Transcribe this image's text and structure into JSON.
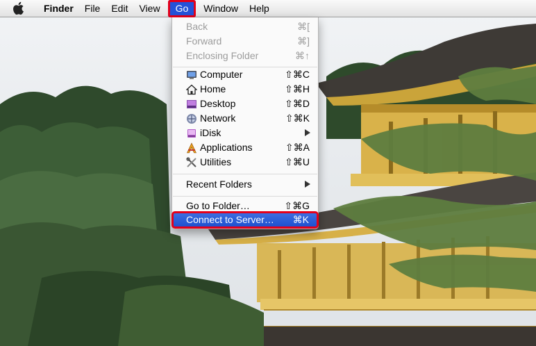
{
  "menubar": {
    "items": [
      "Finder",
      "File",
      "Edit",
      "View",
      "Go",
      "Window",
      "Help"
    ],
    "active": "Go"
  },
  "go_menu": {
    "history": [
      {
        "label": "Back",
        "shortcut": "⌘[",
        "enabled": false
      },
      {
        "label": "Forward",
        "shortcut": "⌘]",
        "enabled": false
      },
      {
        "label": "Enclosing Folder",
        "shortcut": "⌘↑",
        "enabled": false
      }
    ],
    "places": [
      {
        "label": "Computer",
        "shortcut": "⇧⌘C",
        "icon": "computer-icon"
      },
      {
        "label": "Home",
        "shortcut": "⇧⌘H",
        "icon": "home-icon"
      },
      {
        "label": "Desktop",
        "shortcut": "⇧⌘D",
        "icon": "desktop-icon"
      },
      {
        "label": "Network",
        "shortcut": "⇧⌘K",
        "icon": "network-icon"
      },
      {
        "label": "iDisk",
        "shortcut": "",
        "icon": "idisk-icon",
        "submenu": true
      },
      {
        "label": "Applications",
        "shortcut": "⇧⌘A",
        "icon": "applications-icon"
      },
      {
        "label": "Utilities",
        "shortcut": "⇧⌘U",
        "icon": "utilities-icon"
      }
    ],
    "recent": {
      "label": "Recent Folders",
      "submenu": true
    },
    "goto": {
      "label": "Go to Folder…",
      "shortcut": "⇧⌘G"
    },
    "connect": {
      "label": "Connect to Server…",
      "shortcut": "⌘K",
      "highlighted": true
    }
  },
  "colors": {
    "menu_highlight": "#2552d9",
    "annotation_outline": "#e3001b",
    "disabled_text": "#9c9c9c"
  }
}
